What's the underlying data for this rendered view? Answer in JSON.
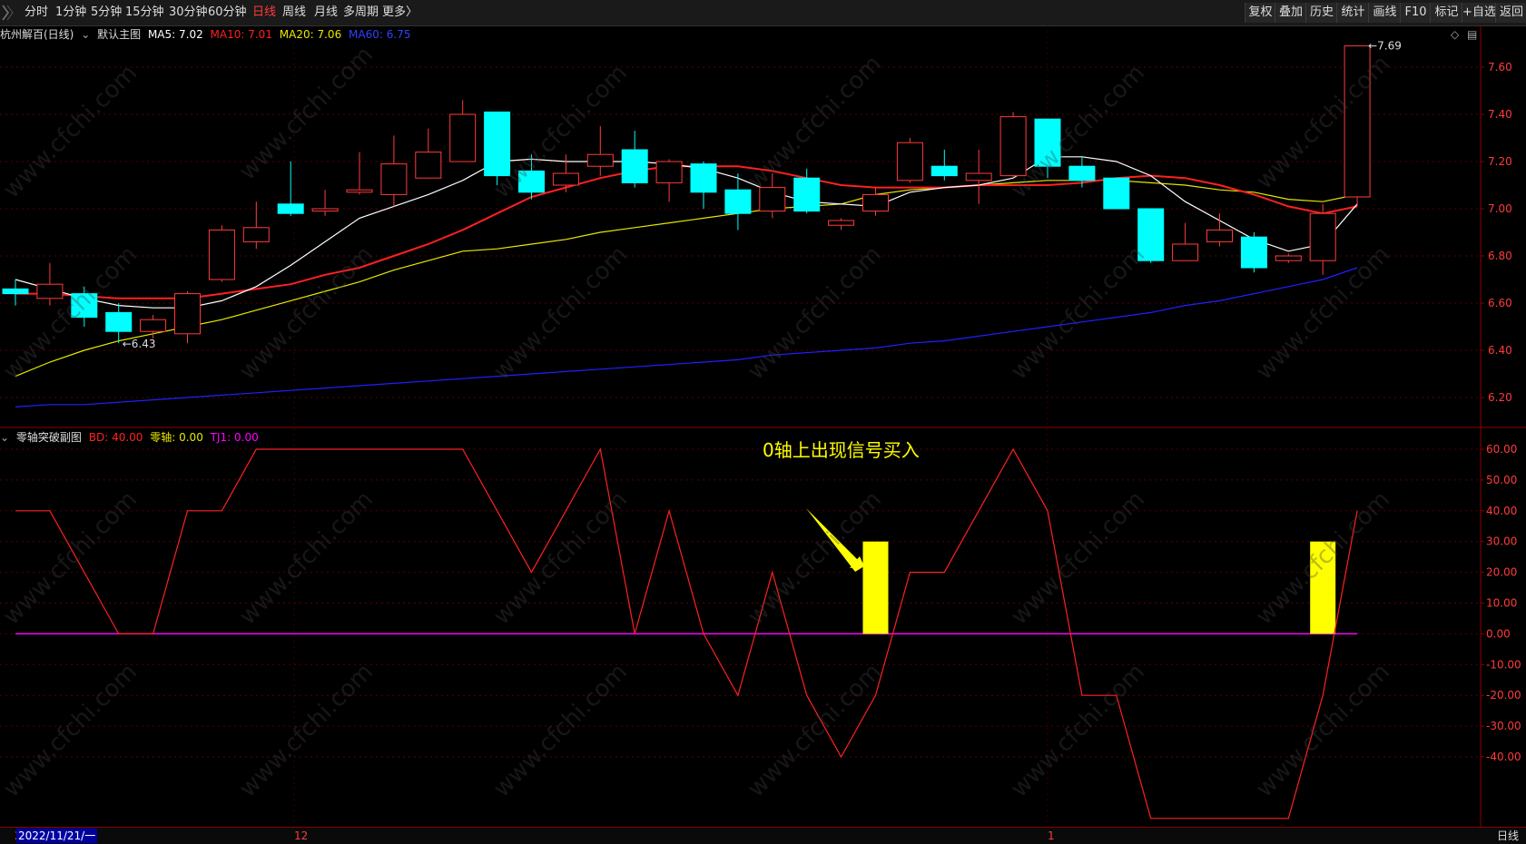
{
  "topbar": {
    "periods": [
      {
        "label": "分时",
        "active": false
      },
      {
        "label": "1分钟",
        "active": false
      },
      {
        "label": "5分钟",
        "active": false
      },
      {
        "label": "15分钟",
        "active": false
      },
      {
        "label": "30分钟",
        "active": false
      },
      {
        "label": "60分钟",
        "active": false
      },
      {
        "label": "日线",
        "active": true
      },
      {
        "label": "周线",
        "active": false
      },
      {
        "label": "月线",
        "active": false
      },
      {
        "label": "多周期",
        "active": false
      },
      {
        "label": "更多〉",
        "active": false
      }
    ],
    "right_buttons": [
      "复权",
      "叠加",
      "历史",
      "统计",
      "画线",
      "F10",
      "标记",
      "+自选",
      "返回"
    ]
  },
  "main_legend": {
    "title": "杭州解百(日线)",
    "chart_name": "默认主图",
    "ma5": "MA5: 7.02",
    "ma10": "MA10: 7.01",
    "ma20": "MA20: 7.06",
    "ma60": "MA60: 6.75"
  },
  "sub_legend": {
    "title": "零轴突破副图",
    "bd": "BD: 40.00",
    "zero": "零轴: 0.00",
    "tj1": "TJ1: 0.00"
  },
  "annotation": "0轴上出现信号买入",
  "bottom": {
    "date_prefix": "20",
    "date": "2022/11/21/一",
    "month_12": "12",
    "month_1": "1",
    "period": "日线"
  },
  "watermark": "www.cfchi.com",
  "colors": {
    "up": "#ff3b3b",
    "down": "#00ffff",
    "ma5": "#ffffff",
    "ma10": "#ff2020",
    "ma20": "#e8e800",
    "ma60": "#2020ff",
    "bd": "#ff2020",
    "signal": "#ffff00",
    "tj1": "#ff00ff"
  },
  "chart_data": [
    {
      "type": "candlestick",
      "title": "杭州解百(日线)",
      "ylim": [
        6.12,
        7.76
      ],
      "y_ticks": [
        "7.60",
        "7.40",
        "7.20",
        "7.00",
        "6.80",
        "6.60",
        "6.40",
        "6.20"
      ],
      "max_label": "7.69",
      "min_label": "6.43",
      "candles": [
        {
          "o": 6.66,
          "h": 6.7,
          "l": 6.59,
          "c": 6.64
        },
        {
          "o": 6.62,
          "h": 6.77,
          "l": 6.59,
          "c": 6.68
        },
        {
          "o": 6.64,
          "h": 6.67,
          "l": 6.5,
          "c": 6.54
        },
        {
          "o": 6.56,
          "h": 6.6,
          "l": 6.43,
          "c": 6.48
        },
        {
          "o": 6.48,
          "h": 6.55,
          "l": 6.45,
          "c": 6.53
        },
        {
          "o": 6.47,
          "h": 6.65,
          "l": 6.43,
          "c": 6.64
        },
        {
          "o": 6.7,
          "h": 6.93,
          "l": 6.69,
          "c": 6.91
        },
        {
          "o": 6.86,
          "h": 7.03,
          "l": 6.83,
          "c": 6.92
        },
        {
          "o": 7.02,
          "h": 7.2,
          "l": 6.97,
          "c": 6.98
        },
        {
          "o": 6.99,
          "h": 7.08,
          "l": 6.97,
          "c": 7.0
        },
        {
          "o": 7.07,
          "h": 7.24,
          "l": 7.06,
          "c": 7.08
        },
        {
          "o": 7.06,
          "h": 7.31,
          "l": 7.01,
          "c": 7.19
        },
        {
          "o": 7.13,
          "h": 7.34,
          "l": 7.13,
          "c": 7.24
        },
        {
          "o": 7.2,
          "h": 7.46,
          "l": 7.2,
          "c": 7.4
        },
        {
          "o": 7.41,
          "h": 7.41,
          "l": 7.1,
          "c": 7.14
        },
        {
          "o": 7.16,
          "h": 7.23,
          "l": 7.04,
          "c": 7.07
        },
        {
          "o": 7.1,
          "h": 7.23,
          "l": 7.07,
          "c": 7.15
        },
        {
          "o": 7.18,
          "h": 7.35,
          "l": 7.14,
          "c": 7.23
        },
        {
          "o": 7.25,
          "h": 7.33,
          "l": 7.09,
          "c": 7.11
        },
        {
          "o": 7.11,
          "h": 7.21,
          "l": 7.03,
          "c": 7.2
        },
        {
          "o": 7.19,
          "h": 7.2,
          "l": 7.0,
          "c": 7.07
        },
        {
          "o": 7.08,
          "h": 7.15,
          "l": 6.91,
          "c": 6.98
        },
        {
          "o": 6.99,
          "h": 7.15,
          "l": 6.96,
          "c": 7.09
        },
        {
          "o": 7.13,
          "h": 7.17,
          "l": 6.98,
          "c": 6.99
        },
        {
          "o": 6.93,
          "h": 6.96,
          "l": 6.91,
          "c": 6.95
        },
        {
          "o": 6.99,
          "h": 7.09,
          "l": 6.97,
          "c": 7.06
        },
        {
          "o": 7.12,
          "h": 7.3,
          "l": 7.11,
          "c": 7.28
        },
        {
          "o": 7.18,
          "h": 7.25,
          "l": 7.12,
          "c": 7.14
        },
        {
          "o": 7.12,
          "h": 7.25,
          "l": 7.02,
          "c": 7.15
        },
        {
          "o": 7.14,
          "h": 7.41,
          "l": 7.13,
          "c": 7.39
        },
        {
          "o": 7.38,
          "h": 7.38,
          "l": 7.13,
          "c": 7.18
        },
        {
          "o": 7.18,
          "h": 7.22,
          "l": 7.09,
          "c": 7.12
        },
        {
          "o": 7.13,
          "h": 7.13,
          "l": 7.0,
          "c": 7.0
        },
        {
          "o": 7.0,
          "h": 7.0,
          "l": 6.77,
          "c": 6.78
        },
        {
          "o": 6.78,
          "h": 6.94,
          "l": 6.78,
          "c": 6.85
        },
        {
          "o": 6.86,
          "h": 6.98,
          "l": 6.84,
          "c": 6.91
        },
        {
          "o": 6.88,
          "h": 6.9,
          "l": 6.73,
          "c": 6.75
        },
        {
          "o": 6.78,
          "h": 6.81,
          "l": 6.77,
          "c": 6.8
        },
        {
          "o": 6.78,
          "h": 7.02,
          "l": 6.72,
          "c": 6.98
        },
        {
          "o": 7.05,
          "h": 7.69,
          "l": 7.01,
          "c": 7.69
        }
      ],
      "ma5": [
        6.7,
        6.66,
        6.62,
        6.59,
        6.58,
        6.58,
        6.61,
        6.67,
        6.76,
        6.86,
        6.96,
        7.01,
        7.06,
        7.12,
        7.2,
        7.21,
        7.2,
        7.2,
        7.2,
        7.19,
        7.17,
        7.13,
        7.07,
        7.03,
        7.02,
        7.01,
        7.07,
        7.09,
        7.1,
        7.13,
        7.22,
        7.22,
        7.2,
        7.14,
        7.03,
        6.95,
        6.87,
        6.82,
        6.85,
        7.02
      ],
      "ma10": [
        6.64,
        6.64,
        6.63,
        6.62,
        6.62,
        6.62,
        6.64,
        6.66,
        6.68,
        6.72,
        6.75,
        6.8,
        6.85,
        6.91,
        6.98,
        7.05,
        7.09,
        7.13,
        7.16,
        7.18,
        7.18,
        7.18,
        7.16,
        7.13,
        7.1,
        7.09,
        7.09,
        7.09,
        7.1,
        7.1,
        7.1,
        7.11,
        7.13,
        7.14,
        7.13,
        7.1,
        7.06,
        7.01,
        6.98,
        7.01
      ],
      "ma20": [
        6.29,
        6.35,
        6.4,
        6.44,
        6.47,
        6.5,
        6.53,
        6.57,
        6.61,
        6.65,
        6.69,
        6.74,
        6.78,
        6.82,
        6.83,
        6.85,
        6.87,
        6.9,
        6.92,
        6.94,
        6.96,
        6.98,
        7.0,
        7.01,
        7.02,
        7.06,
        7.08,
        7.09,
        7.1,
        7.11,
        7.12,
        7.12,
        7.12,
        7.11,
        7.1,
        7.08,
        7.07,
        7.04,
        7.03,
        7.06
      ],
      "ma60": [
        6.16,
        6.17,
        6.17,
        6.18,
        6.19,
        6.2,
        6.21,
        6.22,
        6.23,
        6.24,
        6.25,
        6.26,
        6.27,
        6.28,
        6.29,
        6.3,
        6.31,
        6.32,
        6.33,
        6.34,
        6.35,
        6.36,
        6.38,
        6.39,
        6.4,
        6.41,
        6.43,
        6.44,
        6.46,
        6.48,
        6.5,
        6.52,
        6.54,
        6.56,
        6.59,
        6.61,
        6.64,
        6.67,
        6.7,
        6.75
      ]
    },
    {
      "type": "line",
      "title": "零轴突破副图",
      "ylim": [
        -60,
        66
      ],
      "y_ticks": [
        "60.00",
        "50.00",
        "40.00",
        "30.00",
        "20.00",
        "10.00",
        "0.00",
        "-10.00",
        "-20.00",
        "-30.00",
        "-40.00"
      ],
      "series": [
        {
          "name": "BD",
          "values": [
            40,
            40,
            20,
            0,
            0,
            40,
            40,
            60,
            60,
            60,
            60,
            60,
            60,
            60,
            40,
            20,
            40,
            60,
            0,
            40,
            0,
            -20,
            20,
            -20,
            -40,
            -20,
            20,
            20,
            40,
            60,
            40,
            -20,
            -20,
            -60,
            -60,
            -60,
            -60,
            -60,
            -20,
            40
          ]
        },
        {
          "name": "信号",
          "values": [
            0,
            0,
            0,
            0,
            0,
            0,
            0,
            0,
            0,
            0,
            0,
            0,
            0,
            0,
            0,
            0,
            0,
            0,
            0,
            0,
            0,
            0,
            0,
            0,
            0,
            30,
            0,
            0,
            0,
            0,
            0,
            0,
            0,
            0,
            0,
            0,
            0,
            0,
            30,
            0
          ]
        }
      ]
    }
  ]
}
